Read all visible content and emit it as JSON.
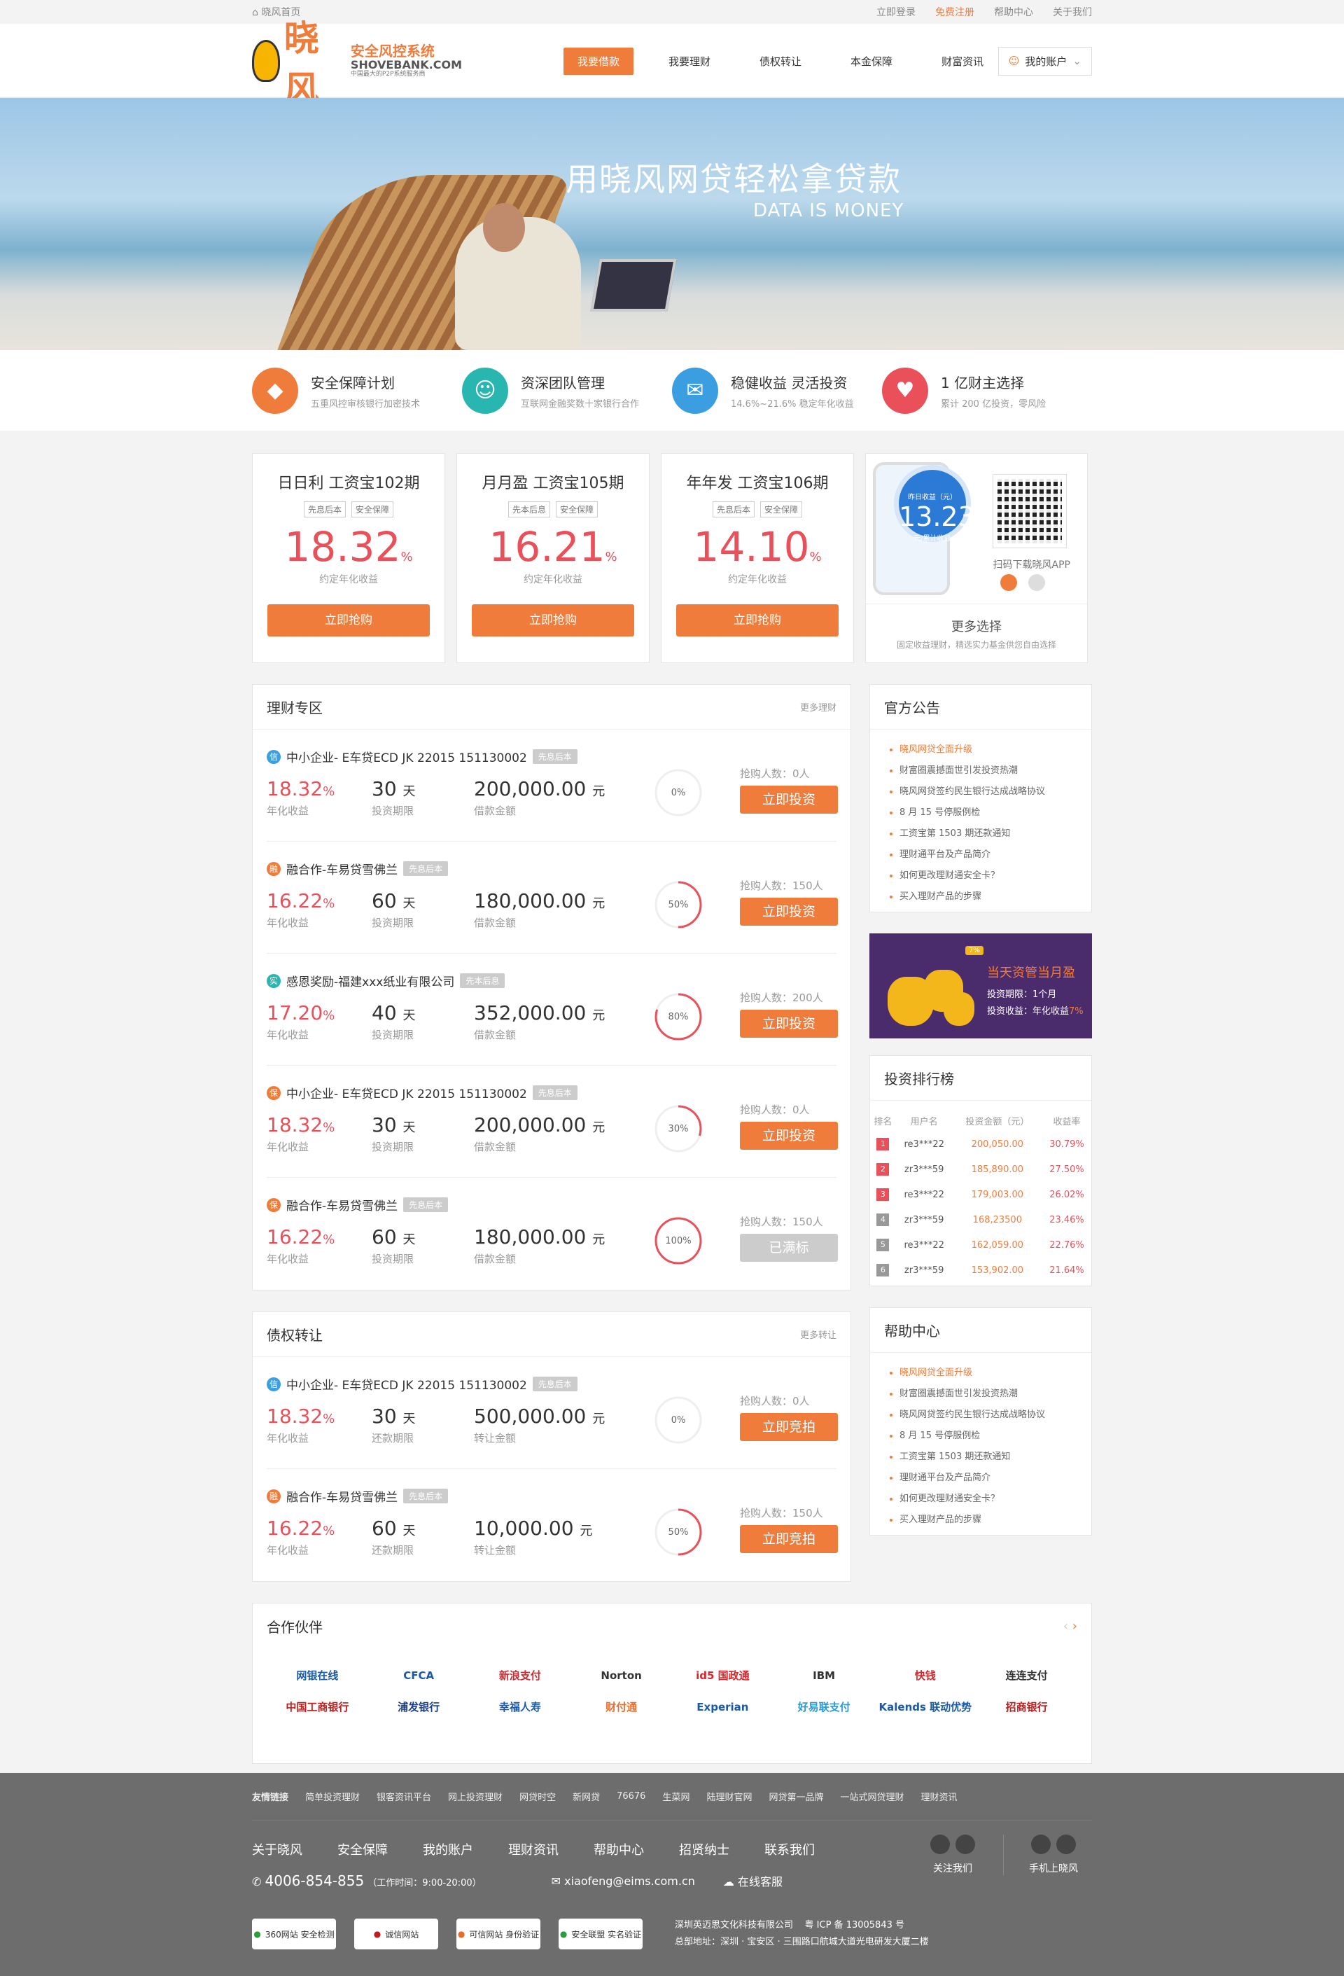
{
  "topbar": {
    "home": "晓风首页",
    "links": [
      "立即登录",
      "免费注册",
      "帮助中心",
      "关于我们"
    ]
  },
  "logo": {
    "big": "晓风",
    "line1": "安全风控系统",
    "line2": "SHOVEBANK.COM",
    "line3": "中国最大的P2P系统服务商"
  },
  "nav": [
    "我要借款",
    "我要理财",
    "债权转让",
    "本金保障",
    "财富资讯"
  ],
  "account": "我的账户",
  "banner": {
    "title": "用晓风网贷轻松拿贷款",
    "subtitle": "DATA IS MONEY"
  },
  "features": [
    {
      "title": "安全保障计划",
      "desc": "五重风控审核银行加密技术",
      "icon": "shield-icon",
      "color": "#f07c3c"
    },
    {
      "title": "资深团队管理",
      "desc": "互联网金融奖数十家银行合作",
      "icon": "user-icon",
      "color": "#2ab6b0"
    },
    {
      "title": "稳健收益 灵活投资",
      "desc": "14.6%~21.6% 稳定年化收益",
      "icon": "chat-icon",
      "color": "#3a9ee0"
    },
    {
      "title": "1 亿财主选择",
      "desc": "累计 200 亿投资，零风险",
      "icon": "piggy-bank-icon",
      "color": "#e9505a"
    }
  ],
  "products": [
    {
      "name": "日日利 工资宝102期",
      "tags": [
        "先息后本",
        "安全保障"
      ],
      "rate": "18.32",
      "unit": "%",
      "label": "约定年化收益",
      "button": "立即抢购"
    },
    {
      "name": "月月盈 工资宝105期",
      "tags": [
        "先本后息",
        "安全保障"
      ],
      "rate": "16.21",
      "unit": "%",
      "label": "约定年化收益",
      "button": "立即抢购"
    },
    {
      "name": "年年发 工资宝106期",
      "tags": [
        "先息后本",
        "安全保障"
      ],
      "rate": "14.10",
      "unit": "%",
      "label": "约定年化收益",
      "button": "立即抢购"
    }
  ],
  "app": {
    "circle_small": "昨日收益（元）",
    "circle_value": "13.23",
    "circle_small2": "元/累计收益",
    "qr_label": "扫码下载晓风APP",
    "more": "更多选择",
    "more_desc": "固定收益理财，精选实力基金供您自由选择"
  },
  "licai": {
    "title": "理财专区",
    "more": "更多理财",
    "items": [
      {
        "icon": "信",
        "icon_color": "#3a9ee0",
        "title": "中小企业- E车贷ECD JK 22015 151130002",
        "tag": "先息后本",
        "rate": "18.32",
        "days": "30",
        "amount": "200,000.00",
        "rate_label": "年化收益",
        "days_label": "投资期限",
        "amount_label": "借款金额",
        "percent": 0,
        "percent_text": "0%",
        "count": "抢购人数：0人",
        "button": "立即投资",
        "gray": false
      },
      {
        "icon": "融",
        "icon_color": "#f07c3c",
        "title": "融合作-车易贷雪佛兰",
        "tag": "先息后本",
        "rate": "16.22",
        "days": "60",
        "amount": "180,000.00",
        "rate_label": "年化收益",
        "days_label": "投资期限",
        "amount_label": "借款金额",
        "percent": 50,
        "percent_text": "50%",
        "count": "抢购人数：150人",
        "button": "立即投资",
        "gray": false
      },
      {
        "icon": "实",
        "icon_color": "#2ab6b0",
        "title": "感恩奖励-福建xxx纸业有限公司",
        "tag": "先本后息",
        "rate": "17.20",
        "days": "40",
        "amount": "352,000.00",
        "rate_label": "年化收益",
        "days_label": "投资期限",
        "amount_label": "借款金额",
        "percent": 80,
        "percent_text": "80%",
        "count": "抢购人数：200人",
        "button": "立即投资",
        "gray": false
      },
      {
        "icon": "保",
        "icon_color": "#f07c3c",
        "title": "中小企业- E车贷ECD JK 22015 151130002",
        "tag": "先息后本",
        "rate": "18.32",
        "days": "30",
        "amount": "200,000.00",
        "rate_label": "年化收益",
        "days_label": "投资期限",
        "amount_label": "借款金额",
        "percent": 30,
        "percent_text": "30%",
        "count": "抢购人数：0人",
        "button": "立即投资",
        "gray": false
      },
      {
        "icon": "保",
        "icon_color": "#f07c3c",
        "title": "融合作-车易贷雪佛兰",
        "tag": "先息后本",
        "rate": "16.22",
        "days": "60",
        "amount": "180,000.00",
        "rate_label": "年化收益",
        "days_label": "投资期限",
        "amount_label": "借款金额",
        "percent": 100,
        "percent_text": "100%",
        "count": "抢购人数：150人",
        "button": "已满标",
        "gray": true
      }
    ]
  },
  "zhaiquan": {
    "title": "债权转让",
    "more": "更多转让",
    "items": [
      {
        "icon": "信",
        "icon_color": "#3a9ee0",
        "title": "中小企业- E车贷ECD JK 22015 151130002",
        "tag": "先息后本",
        "rate": "18.32",
        "days": "30",
        "amount": "500,000.00",
        "rate_label": "年化收益",
        "days_label": "还款期限",
        "amount_label": "转让金额",
        "percent": 0,
        "percent_text": "0%",
        "count": "抢购人数：0人",
        "button": "立即竞拍",
        "gray": false
      },
      {
        "icon": "融",
        "icon_color": "#f07c3c",
        "title": "融合作-车易贷雪佛兰",
        "tag": "先息后本",
        "rate": "16.22",
        "days": "60",
        "amount": "10,000.00",
        "rate_label": "年化收益",
        "days_label": "还款期限",
        "amount_label": "转让金额",
        "percent": 50,
        "percent_text": "50%",
        "count": "抢购人数：150人",
        "button": "立即竞拍",
        "gray": false
      }
    ]
  },
  "units": {
    "percent": "%",
    "day": "天",
    "yuan": "元"
  },
  "notice": {
    "title": "官方公告",
    "items": [
      "晓风网贷全面升级",
      "财富圈震撼面世引发投资热潮",
      "晓风网贷签约民生银行达成战略协议",
      "8 月 15 号停服例检",
      "工资宝第 1503 期还款通知",
      "理财通平台及产品简介",
      "如何更改理财通安全卡？",
      "买入理财产品的步骤"
    ]
  },
  "ad": {
    "pct": "7%",
    "title": "当天资管当月盈",
    "line1": "投资期限：1个月",
    "line2_prefix": "投资收益：年化收益",
    "line2_value": "7%"
  },
  "rank": {
    "title": "投资排行榜",
    "headers": [
      "排名",
      "用户名",
      "投资金额（元）",
      "收益率"
    ],
    "rows": [
      [
        "1",
        "re3***22",
        "200,050.00",
        "30.79%"
      ],
      [
        "2",
        "zr3***59",
        "185,890.00",
        "27.50%"
      ],
      [
        "3",
        "re3***22",
        "179,003.00",
        "26.02%"
      ],
      [
        "4",
        "zr3***59",
        "168,23500",
        "23.46%"
      ],
      [
        "5",
        "re3***22",
        "162,059.00",
        "22.76%"
      ],
      [
        "6",
        "zr3***59",
        "153,902.00",
        "21.64%"
      ]
    ]
  },
  "help": {
    "title": "帮助中心",
    "items": [
      "晓风网贷全面升级",
      "财富圈震撼面世引发投资热潮",
      "晓风网贷签约民生银行达成战略协议",
      "8 月 15 号停服例检",
      "工资宝第 1503 期还款通知",
      "理财通平台及产品简介",
      "如何更改理财通安全卡？",
      "买入理财产品的步骤"
    ]
  },
  "partners": {
    "title": "合作伙伴",
    "logos": [
      {
        "name": "网银在线",
        "color": "#1a5aa8"
      },
      {
        "name": "CFCA",
        "color": "#1a5aa8"
      },
      {
        "name": "新浪支付",
        "color": "#d6262c"
      },
      {
        "name": "Norton",
        "color": "#333"
      },
      {
        "name": "id5 国政通",
        "color": "#d6262c"
      },
      {
        "name": "IBM",
        "color": "#333"
      },
      {
        "name": "快钱",
        "color": "#d6262c"
      },
      {
        "name": "连连支付",
        "color": "#333"
      },
      {
        "name": "中国工商银行",
        "color": "#c21b1b"
      },
      {
        "name": "浦发银行",
        "color": "#1a3e8a"
      },
      {
        "name": "幸福人寿",
        "color": "#1a5aa8"
      },
      {
        "name": "财付通",
        "color": "#e96d2a"
      },
      {
        "name": "Experian",
        "color": "#1a5aa8"
      },
      {
        "name": "好易联支付",
        "color": "#2a9ad6"
      },
      {
        "name": "Kalends 联动优势",
        "color": "#1a5aa8"
      },
      {
        "name": "招商银行",
        "color": "#c21b1b"
      }
    ]
  },
  "footer": {
    "links_label": "友情链接",
    "links": [
      "简单投资理财",
      "银客资讯平台",
      "网上投资理财",
      "网贷时空",
      "新网贷",
      "76676",
      "生菜网",
      "陆理财官网",
      "网贷第一品牌",
      "一站式网贷理财",
      "理财资讯"
    ],
    "nav": [
      "关于晓风",
      "安全保障",
      "我的账户",
      "理财资讯",
      "帮助中心",
      "招贤纳士",
      "联系我们"
    ],
    "phone": "4006-854-855",
    "hours": "（工作时间：9:00-20:00）",
    "email": "xiaofeng@eims.com.cn",
    "service": "在线客服",
    "follow": "关注我们",
    "mobile": "手机上晓风",
    "badges": [
      "360网站 安全检测",
      "诚信网站",
      "可信网站 身份验证",
      "安全联盟 实名验证"
    ],
    "company": "深圳英迈思文化科技有限公司",
    "icp": "粤 ICP 备 13005843 号",
    "address": "总部地址：深圳 · 宝安区 · 三围路口航城大道光电研发大厦二楼"
  }
}
